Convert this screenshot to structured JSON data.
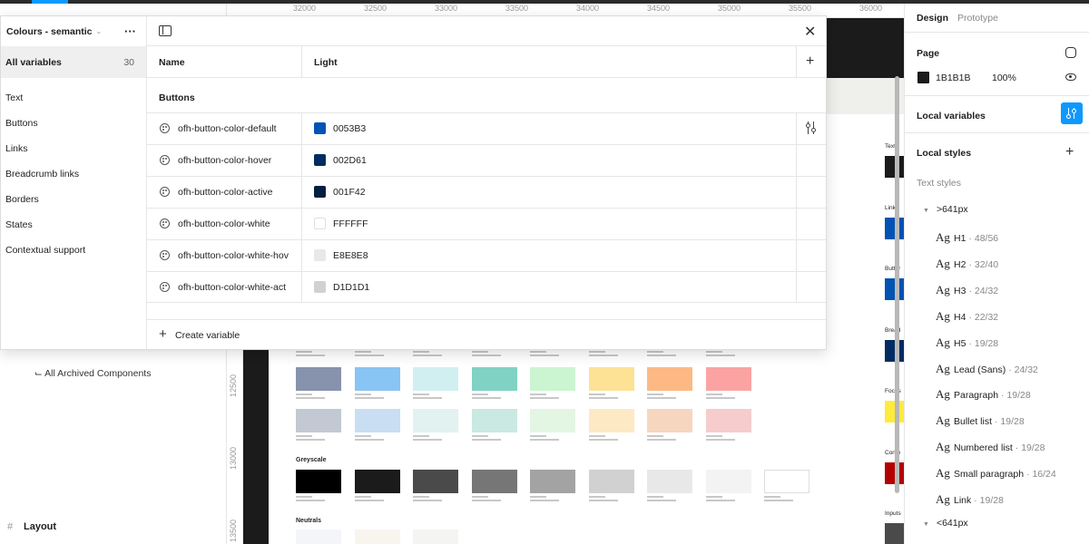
{
  "canvas": {
    "ruler_top": [
      "32000",
      "32500",
      "33000",
      "33500",
      "34000",
      "34500",
      "35000",
      "35500",
      "36000"
    ],
    "ruler_left": [
      "12500",
      "13000",
      "13500"
    ],
    "sections": {
      "greyscale": "Greyscale",
      "neutrals": "Neutrals"
    },
    "right_labels": [
      "Text",
      "Links",
      "Buttor",
      "Bread",
      "Focus",
      "Conte",
      "Inputs"
    ],
    "pastel_row_1": [
      "#8792ac",
      "#88c4f4",
      "#d1eff1",
      "#80d2c4",
      "#cbf5d0",
      "#fde195",
      "#fdb983",
      "#fba3a3"
    ],
    "pastel_row_2": [
      "#c3c9d2",
      "#c9def2",
      "#e2f2f0",
      "#c9e9e2",
      "#e3f6e3",
      "#fde9c4",
      "#f7d6c0",
      "#f6cccc"
    ],
    "greyscale_row": [
      "#000000",
      "#1b1b1b",
      "#4a4a4a",
      "#767676",
      "#a3a3a3",
      "#d1d1d1",
      "#e8e8e8",
      "#f3f3f3",
      "#ffffff"
    ],
    "neutrals_row": [
      "#f4f5f9",
      "#f8f5ef",
      "#f4f4f2"
    ],
    "right_swatches": [
      "#1b1b1b",
      "#0053b3",
      "#0053b3",
      "#002d61",
      "#ffeb3b",
      "#b30000",
      "#4a4a4a"
    ]
  },
  "layer_panel": {
    "archived": "⌙ All Archived Components",
    "layout": "Layout"
  },
  "variables_modal": {
    "collection": "Colours - semantic",
    "all_label": "All variables",
    "all_count": "30",
    "groups": [
      "Text",
      "Buttons",
      "Links",
      "Breadcrumb links",
      "Borders",
      "States",
      "Contextual support"
    ],
    "col_name": "Name",
    "col_light": "Light",
    "group_label": "Buttons",
    "rows": [
      {
        "name": "ofh-button-color-default",
        "hex": "0053B3",
        "color": "#0053B3"
      },
      {
        "name": "ofh-button-color-hover",
        "hex": "002D61",
        "color": "#002D61"
      },
      {
        "name": "ofh-button-color-active",
        "hex": "001F42",
        "color": "#001F42"
      },
      {
        "name": "ofh-button-color-white",
        "hex": "FFFFFF",
        "color": "#FFFFFF"
      },
      {
        "name": "ofh-button-color-white-hov",
        "hex": "E8E8E8",
        "color": "#E8E8E8"
      },
      {
        "name": "ofh-button-color-white-act",
        "hex": "D1D1D1",
        "color": "#D1D1D1"
      }
    ],
    "create_label": "Create variable"
  },
  "design_panel": {
    "tab_design": "Design",
    "tab_prototype": "Prototype",
    "page_title": "Page",
    "page_hex": "1B1B1B",
    "page_opacity": "100%",
    "local_variables": "Local variables",
    "local_styles": "Local styles",
    "text_styles": "Text styles",
    "bp_large": ">641px",
    "bp_small": "<641px",
    "styles": [
      {
        "name": "H1",
        "meta": "· 48/56"
      },
      {
        "name": "H2",
        "meta": "· 32/40"
      },
      {
        "name": "H3",
        "meta": "· 24/32"
      },
      {
        "name": "H4",
        "meta": "· 22/32"
      },
      {
        "name": "H5",
        "meta": "· 19/28"
      },
      {
        "name": "Lead (Sans)",
        "meta": "· 24/32"
      },
      {
        "name": "Paragraph",
        "meta": "· 19/28"
      },
      {
        "name": "Bullet list",
        "meta": "· 19/28"
      },
      {
        "name": "Numbered list",
        "meta": "· 19/28"
      },
      {
        "name": "Small paragraph",
        "meta": "· 16/24"
      },
      {
        "name": "Link",
        "meta": "· 19/28"
      }
    ],
    "style_glyph": "Ag"
  }
}
